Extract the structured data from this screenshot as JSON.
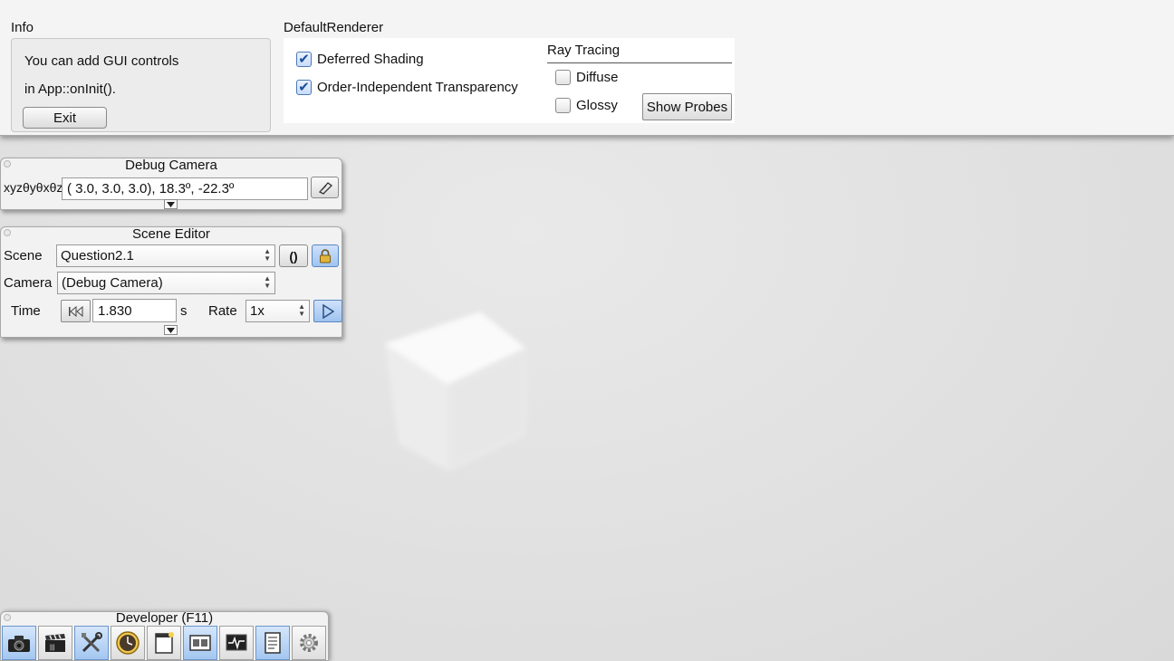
{
  "info": {
    "title": "Info",
    "line1": "You can add GUI controls",
    "line2": "in App::onInit().",
    "exit_label": "Exit"
  },
  "renderer": {
    "title": "DefaultRenderer",
    "deferred_shading": {
      "label": "Deferred Shading",
      "checked": true
    },
    "oit": {
      "label": "Order-Independent Transparency",
      "checked": true
    },
    "ray_tracing": {
      "title": "Ray Tracing",
      "diffuse": {
        "label": "Diffuse",
        "checked": false
      },
      "glossy": {
        "label": "Glossy",
        "checked": false
      },
      "show_probes_label": "Show Probes"
    }
  },
  "debug_camera": {
    "title": "Debug Camera",
    "coords_label": "xyzθyθxθz",
    "coords_value": "(  3.0,   3.0,   3.0),  18.3º, -22.3º"
  },
  "scene_editor": {
    "title": "Scene Editor",
    "scene_label": "Scene",
    "scene_value": "Question2.1",
    "camera_label": "Camera",
    "camera_value": "(Debug Camera)",
    "time_label": "Time",
    "time_value": "1.830",
    "time_unit": "s",
    "rate_label": "Rate",
    "rate_value": "1x"
  },
  "developer": {
    "title": "Developer (F11)",
    "icons": [
      "camera-icon",
      "clapperboard-icon",
      "tools-icon",
      "clock-icon",
      "window-icon",
      "scene-layout-icon",
      "profiler-icon",
      "log-icon",
      "gear-icon"
    ]
  },
  "colors": {
    "accent_blue": "#9fc3ef",
    "check_blue": "#1b4e9c",
    "background": "#e2e2e2"
  }
}
